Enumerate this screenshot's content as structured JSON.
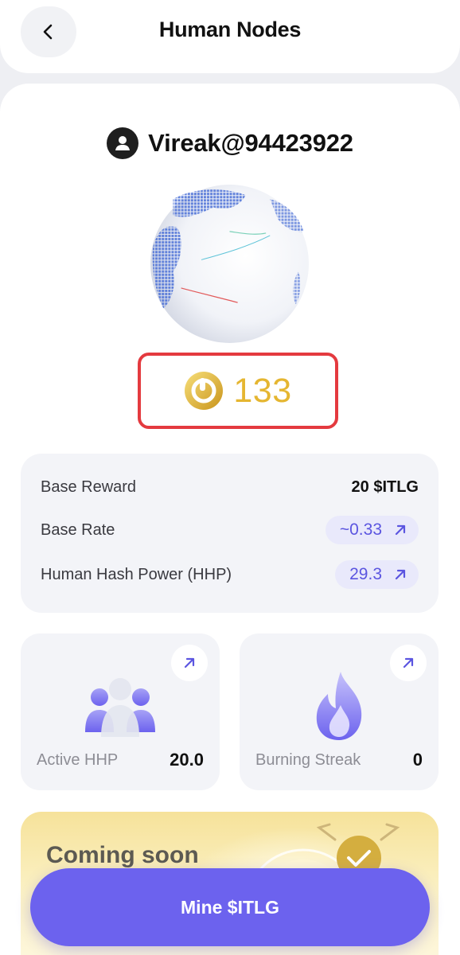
{
  "header": {
    "title": "Human Nodes"
  },
  "profile": {
    "username": "Vireak@94423922"
  },
  "balance": {
    "value": "133"
  },
  "stats": [
    {
      "label": "Base Reward",
      "value": "20 $ITLG"
    },
    {
      "label": "Base Rate",
      "value": "~0.33"
    },
    {
      "label": "Human Hash Power (HHP)",
      "value": "29.3"
    }
  ],
  "tiles": {
    "active_hhp": {
      "label": "Active HHP",
      "value": "20.0",
      "icon": "users-icon"
    },
    "burning_streak": {
      "label": "Burning Streak",
      "value": "0",
      "icon": "flame-icon"
    }
  },
  "promo": {
    "title": "Coming soon"
  },
  "mine_button": {
    "label": "Mine $ITLG"
  },
  "colors": {
    "accent": "#6c62ee",
    "gold": "#e5b631",
    "highlight_border": "#e43a3f",
    "pill_bg": "#e9e9fb"
  }
}
